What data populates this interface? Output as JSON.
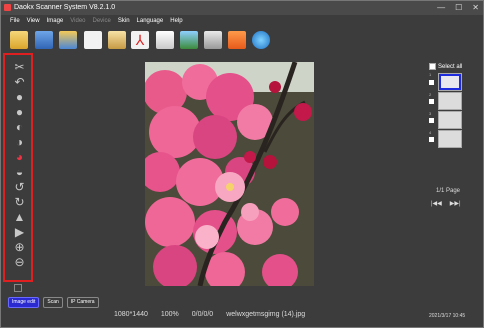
{
  "window": {
    "title": "Daokx Scanner System V8.2.1.0"
  },
  "menu": [
    {
      "label": "File",
      "enabled": true
    },
    {
      "label": "View",
      "enabled": true
    },
    {
      "label": "Image",
      "enabled": true
    },
    {
      "label": "Video",
      "enabled": false
    },
    {
      "label": "Device",
      "enabled": false
    },
    {
      "label": "Skin",
      "enabled": true
    },
    {
      "label": "Language",
      "enabled": true
    },
    {
      "label": "Help",
      "enabled": true
    }
  ],
  "toolbar_icons": [
    "open-folder-icon",
    "save-icon",
    "scan-icon",
    "document-icon",
    "image-settings-icon",
    "pdf-icon",
    "word-icon",
    "picture-icon",
    "print-icon",
    "ocr-icon",
    "camera-icon"
  ],
  "side_icons": [
    "crop-icon",
    "undo-icon",
    "brightness-down-icon",
    "brightness-up-icon",
    "contrast-down-icon",
    "contrast-up-icon",
    "color-icon",
    "grayscale-icon",
    "rotate-left-icon",
    "rotate-right-icon",
    "flip-vertical-icon",
    "flip-horizontal-icon",
    "zoom-in-icon",
    "zoom-out-icon"
  ],
  "right_panel": {
    "select_all": "Select all",
    "thumb_numbers": [
      "1",
      "2",
      "3",
      "4"
    ],
    "page_info": "1/1 Page",
    "first": "|◀◀",
    "last": "▶▶|"
  },
  "tabs": [
    "Image edit",
    "Scan",
    "IP Camera"
  ],
  "status": {
    "resolution": "1080*1440",
    "zoom": "100%",
    "coords": "0/0/0/0",
    "filename": "welwxgetmsgimg (14).jpg"
  },
  "datetime": "2021/3/17 10:45"
}
